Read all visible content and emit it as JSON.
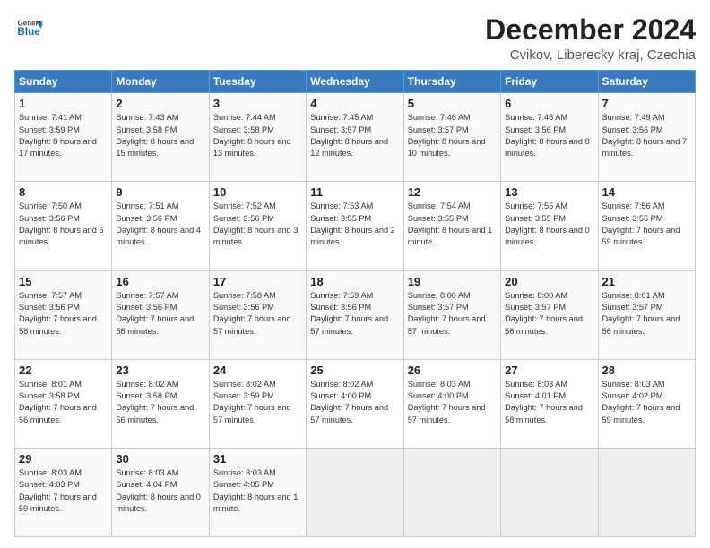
{
  "header": {
    "logo_general": "General",
    "logo_blue": "Blue",
    "title": "December 2024",
    "subtitle": "Cvikov, Liberecky kraj, Czechia"
  },
  "weekdays": [
    "Sunday",
    "Monday",
    "Tuesday",
    "Wednesday",
    "Thursday",
    "Friday",
    "Saturday"
  ],
  "weeks": [
    [
      {
        "day": "1",
        "sunrise": "Sunrise: 7:41 AM",
        "sunset": "Sunset: 3:59 PM",
        "daylight": "Daylight: 8 hours and 17 minutes."
      },
      {
        "day": "2",
        "sunrise": "Sunrise: 7:43 AM",
        "sunset": "Sunset: 3:58 PM",
        "daylight": "Daylight: 8 hours and 15 minutes."
      },
      {
        "day": "3",
        "sunrise": "Sunrise: 7:44 AM",
        "sunset": "Sunset: 3:58 PM",
        "daylight": "Daylight: 8 hours and 13 minutes."
      },
      {
        "day": "4",
        "sunrise": "Sunrise: 7:45 AM",
        "sunset": "Sunset: 3:57 PM",
        "daylight": "Daylight: 8 hours and 12 minutes."
      },
      {
        "day": "5",
        "sunrise": "Sunrise: 7:46 AM",
        "sunset": "Sunset: 3:57 PM",
        "daylight": "Daylight: 8 hours and 10 minutes."
      },
      {
        "day": "6",
        "sunrise": "Sunrise: 7:48 AM",
        "sunset": "Sunset: 3:56 PM",
        "daylight": "Daylight: 8 hours and 8 minutes."
      },
      {
        "day": "7",
        "sunrise": "Sunrise: 7:49 AM",
        "sunset": "Sunset: 3:56 PM",
        "daylight": "Daylight: 8 hours and 7 minutes."
      }
    ],
    [
      {
        "day": "8",
        "sunrise": "Sunrise: 7:50 AM",
        "sunset": "Sunset: 3:56 PM",
        "daylight": "Daylight: 8 hours and 6 minutes."
      },
      {
        "day": "9",
        "sunrise": "Sunrise: 7:51 AM",
        "sunset": "Sunset: 3:56 PM",
        "daylight": "Daylight: 8 hours and 4 minutes."
      },
      {
        "day": "10",
        "sunrise": "Sunrise: 7:52 AM",
        "sunset": "Sunset: 3:56 PM",
        "daylight": "Daylight: 8 hours and 3 minutes."
      },
      {
        "day": "11",
        "sunrise": "Sunrise: 7:53 AM",
        "sunset": "Sunset: 3:55 PM",
        "daylight": "Daylight: 8 hours and 2 minutes."
      },
      {
        "day": "12",
        "sunrise": "Sunrise: 7:54 AM",
        "sunset": "Sunset: 3:55 PM",
        "daylight": "Daylight: 8 hours and 1 minute."
      },
      {
        "day": "13",
        "sunrise": "Sunrise: 7:55 AM",
        "sunset": "Sunset: 3:55 PM",
        "daylight": "Daylight: 8 hours and 0 minutes."
      },
      {
        "day": "14",
        "sunrise": "Sunrise: 7:56 AM",
        "sunset": "Sunset: 3:55 PM",
        "daylight": "Daylight: 7 hours and 59 minutes."
      }
    ],
    [
      {
        "day": "15",
        "sunrise": "Sunrise: 7:57 AM",
        "sunset": "Sunset: 3:56 PM",
        "daylight": "Daylight: 7 hours and 58 minutes."
      },
      {
        "day": "16",
        "sunrise": "Sunrise: 7:57 AM",
        "sunset": "Sunset: 3:56 PM",
        "daylight": "Daylight: 7 hours and 58 minutes."
      },
      {
        "day": "17",
        "sunrise": "Sunrise: 7:58 AM",
        "sunset": "Sunset: 3:56 PM",
        "daylight": "Daylight: 7 hours and 57 minutes."
      },
      {
        "day": "18",
        "sunrise": "Sunrise: 7:59 AM",
        "sunset": "Sunset: 3:56 PM",
        "daylight": "Daylight: 7 hours and 57 minutes."
      },
      {
        "day": "19",
        "sunrise": "Sunrise: 8:00 AM",
        "sunset": "Sunset: 3:57 PM",
        "daylight": "Daylight: 7 hours and 57 minutes."
      },
      {
        "day": "20",
        "sunrise": "Sunrise: 8:00 AM",
        "sunset": "Sunset: 3:57 PM",
        "daylight": "Daylight: 7 hours and 56 minutes."
      },
      {
        "day": "21",
        "sunrise": "Sunrise: 8:01 AM",
        "sunset": "Sunset: 3:57 PM",
        "daylight": "Daylight: 7 hours and 56 minutes."
      }
    ],
    [
      {
        "day": "22",
        "sunrise": "Sunrise: 8:01 AM",
        "sunset": "Sunset: 3:58 PM",
        "daylight": "Daylight: 7 hours and 56 minutes."
      },
      {
        "day": "23",
        "sunrise": "Sunrise: 8:02 AM",
        "sunset": "Sunset: 3:58 PM",
        "daylight": "Daylight: 7 hours and 56 minutes."
      },
      {
        "day": "24",
        "sunrise": "Sunrise: 8:02 AM",
        "sunset": "Sunset: 3:59 PM",
        "daylight": "Daylight: 7 hours and 57 minutes."
      },
      {
        "day": "25",
        "sunrise": "Sunrise: 8:02 AM",
        "sunset": "Sunset: 4:00 PM",
        "daylight": "Daylight: 7 hours and 57 minutes."
      },
      {
        "day": "26",
        "sunrise": "Sunrise: 8:03 AM",
        "sunset": "Sunset: 4:00 PM",
        "daylight": "Daylight: 7 hours and 57 minutes."
      },
      {
        "day": "27",
        "sunrise": "Sunrise: 8:03 AM",
        "sunset": "Sunset: 4:01 PM",
        "daylight": "Daylight: 7 hours and 58 minutes."
      },
      {
        "day": "28",
        "sunrise": "Sunrise: 8:03 AM",
        "sunset": "Sunset: 4:02 PM",
        "daylight": "Daylight: 7 hours and 59 minutes."
      }
    ],
    [
      {
        "day": "29",
        "sunrise": "Sunrise: 8:03 AM",
        "sunset": "Sunset: 4:03 PM",
        "daylight": "Daylight: 7 hours and 59 minutes."
      },
      {
        "day": "30",
        "sunrise": "Sunrise: 8:03 AM",
        "sunset": "Sunset: 4:04 PM",
        "daylight": "Daylight: 8 hours and 0 minutes."
      },
      {
        "day": "31",
        "sunrise": "Sunrise: 8:03 AM",
        "sunset": "Sunset: 4:05 PM",
        "daylight": "Daylight: 8 hours and 1 minute."
      },
      null,
      null,
      null,
      null
    ]
  ]
}
